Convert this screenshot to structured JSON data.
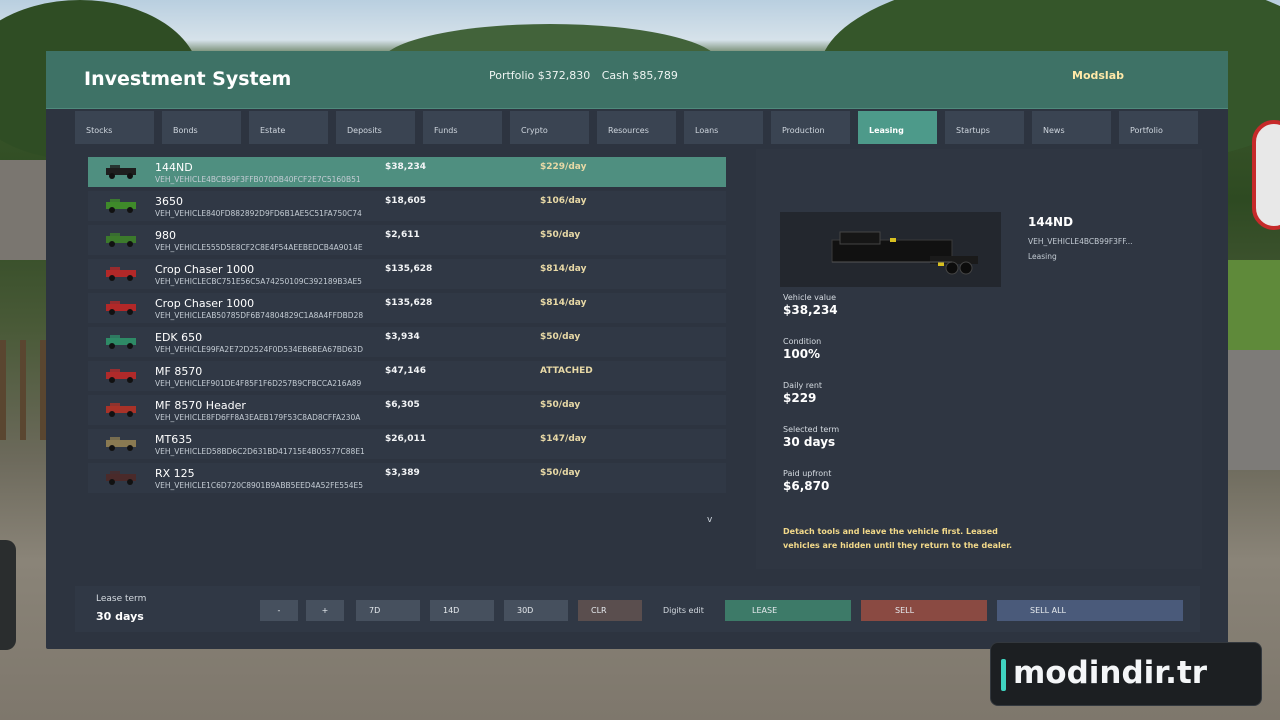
{
  "header": {
    "title": "Investment System",
    "portfolio": "Portfolio $372,830",
    "cash": "Cash $85,789",
    "brand": "Modslab"
  },
  "tabs": [
    {
      "label": "Stocks",
      "active": false
    },
    {
      "label": "Bonds",
      "active": false
    },
    {
      "label": "Estate",
      "active": false
    },
    {
      "label": "Deposits",
      "active": false
    },
    {
      "label": "Funds",
      "active": false
    },
    {
      "label": "Crypto",
      "active": false
    },
    {
      "label": "Resources",
      "active": false
    },
    {
      "label": "Loans",
      "active": false
    },
    {
      "label": "Production",
      "active": false
    },
    {
      "label": "Leasing",
      "active": true
    },
    {
      "label": "Startups",
      "active": false
    },
    {
      "label": "News",
      "active": false
    },
    {
      "label": "Portfolio",
      "active": false
    }
  ],
  "vehicles": [
    {
      "name": "144ND",
      "code": "VEH_VEHICLE4BCB99F3FFB070DB40FCF2E7C5160B51",
      "value": "$38,234",
      "rate": "$229/day",
      "selected": true,
      "color": "#1e1e1e"
    },
    {
      "name": "3650",
      "code": "VEH_VEHICLE840FD882892D9FD6B1AE5C51FA750C74",
      "value": "$18,605",
      "rate": "$106/day",
      "selected": false,
      "color": "#3f8a2a"
    },
    {
      "name": "980",
      "code": "VEH_VEHICLE555D5E8CF2C8E4F54AEEBEDCB4A9014E",
      "value": "$2,611",
      "rate": "$50/day",
      "selected": false,
      "color": "#3c7a2c"
    },
    {
      "name": "Crop Chaser 1000",
      "code": "VEH_VEHICLECBC751E56C5A74250109C392189B3AE5",
      "value": "$135,628",
      "rate": "$814/day",
      "selected": false,
      "color": "#b22828"
    },
    {
      "name": "Crop Chaser 1000",
      "code": "VEH_VEHICLEAB50785DF6B74804829C1A8A4FFDBD28",
      "value": "$135,628",
      "rate": "$814/day",
      "selected": false,
      "color": "#b22828"
    },
    {
      "name": "EDK 650",
      "code": "VEH_VEHICLE99FA2E72D2524F0D534EB6BEA67BD63D",
      "value": "$3,934",
      "rate": "$50/day",
      "selected": false,
      "color": "#2e8a66"
    },
    {
      "name": "MF 8570",
      "code": "VEH_VEHICLEF901DE4F85F1F6D257B9CFBCCA216A89",
      "value": "$47,146",
      "rate": "ATTACHED",
      "selected": false,
      "color": "#b02a2a"
    },
    {
      "name": "MF 8570 Header",
      "code": "VEH_VEHICLE8FD6FF8A3EAEB179F53C8AD8CFFA230A",
      "value": "$6,305",
      "rate": "$50/day",
      "selected": false,
      "color": "#a83228"
    },
    {
      "name": "MT635",
      "code": "VEH_VEHICLED58BD6C2D631BD41715E4B05577C88E1",
      "value": "$26,011",
      "rate": "$147/day",
      "selected": false,
      "color": "#8a7a52"
    },
    {
      "name": "RX 125",
      "code": "VEH_VEHICLE1C6D720C8901B9ABB5EED4A52FE554E5",
      "value": "$3,389",
      "rate": "$50/day",
      "selected": false,
      "color": "#4a2a2a"
    }
  ],
  "list_more_icon": "v",
  "detail": {
    "name": "144ND",
    "code": "VEH_VEHICLE4BCB99F3FF...",
    "status": "Leasing",
    "metrics": [
      {
        "label": "Vehicle value",
        "value": "$38,234"
      },
      {
        "label": "Condition",
        "value": "100%"
      },
      {
        "label": "Daily rent",
        "value": "$229"
      },
      {
        "label": "Selected term",
        "value": "30 days"
      },
      {
        "label": "Paid upfront",
        "value": "$6,870"
      }
    ],
    "note": "Detach tools and leave the vehicle first. Leased vehicles are hidden until they return to the dealer."
  },
  "footer": {
    "lease_term_label": "Lease term",
    "lease_term_value": "30 days",
    "minus": "-",
    "plus": "+",
    "d7": "7D",
    "d14": "14D",
    "d30": "30D",
    "clr": "CLR",
    "digits_edit": "Digits edit",
    "lease": "LEASE",
    "sell": "SELL",
    "sell_all": "SELL ALL"
  },
  "watermark": "modindir.tr"
}
